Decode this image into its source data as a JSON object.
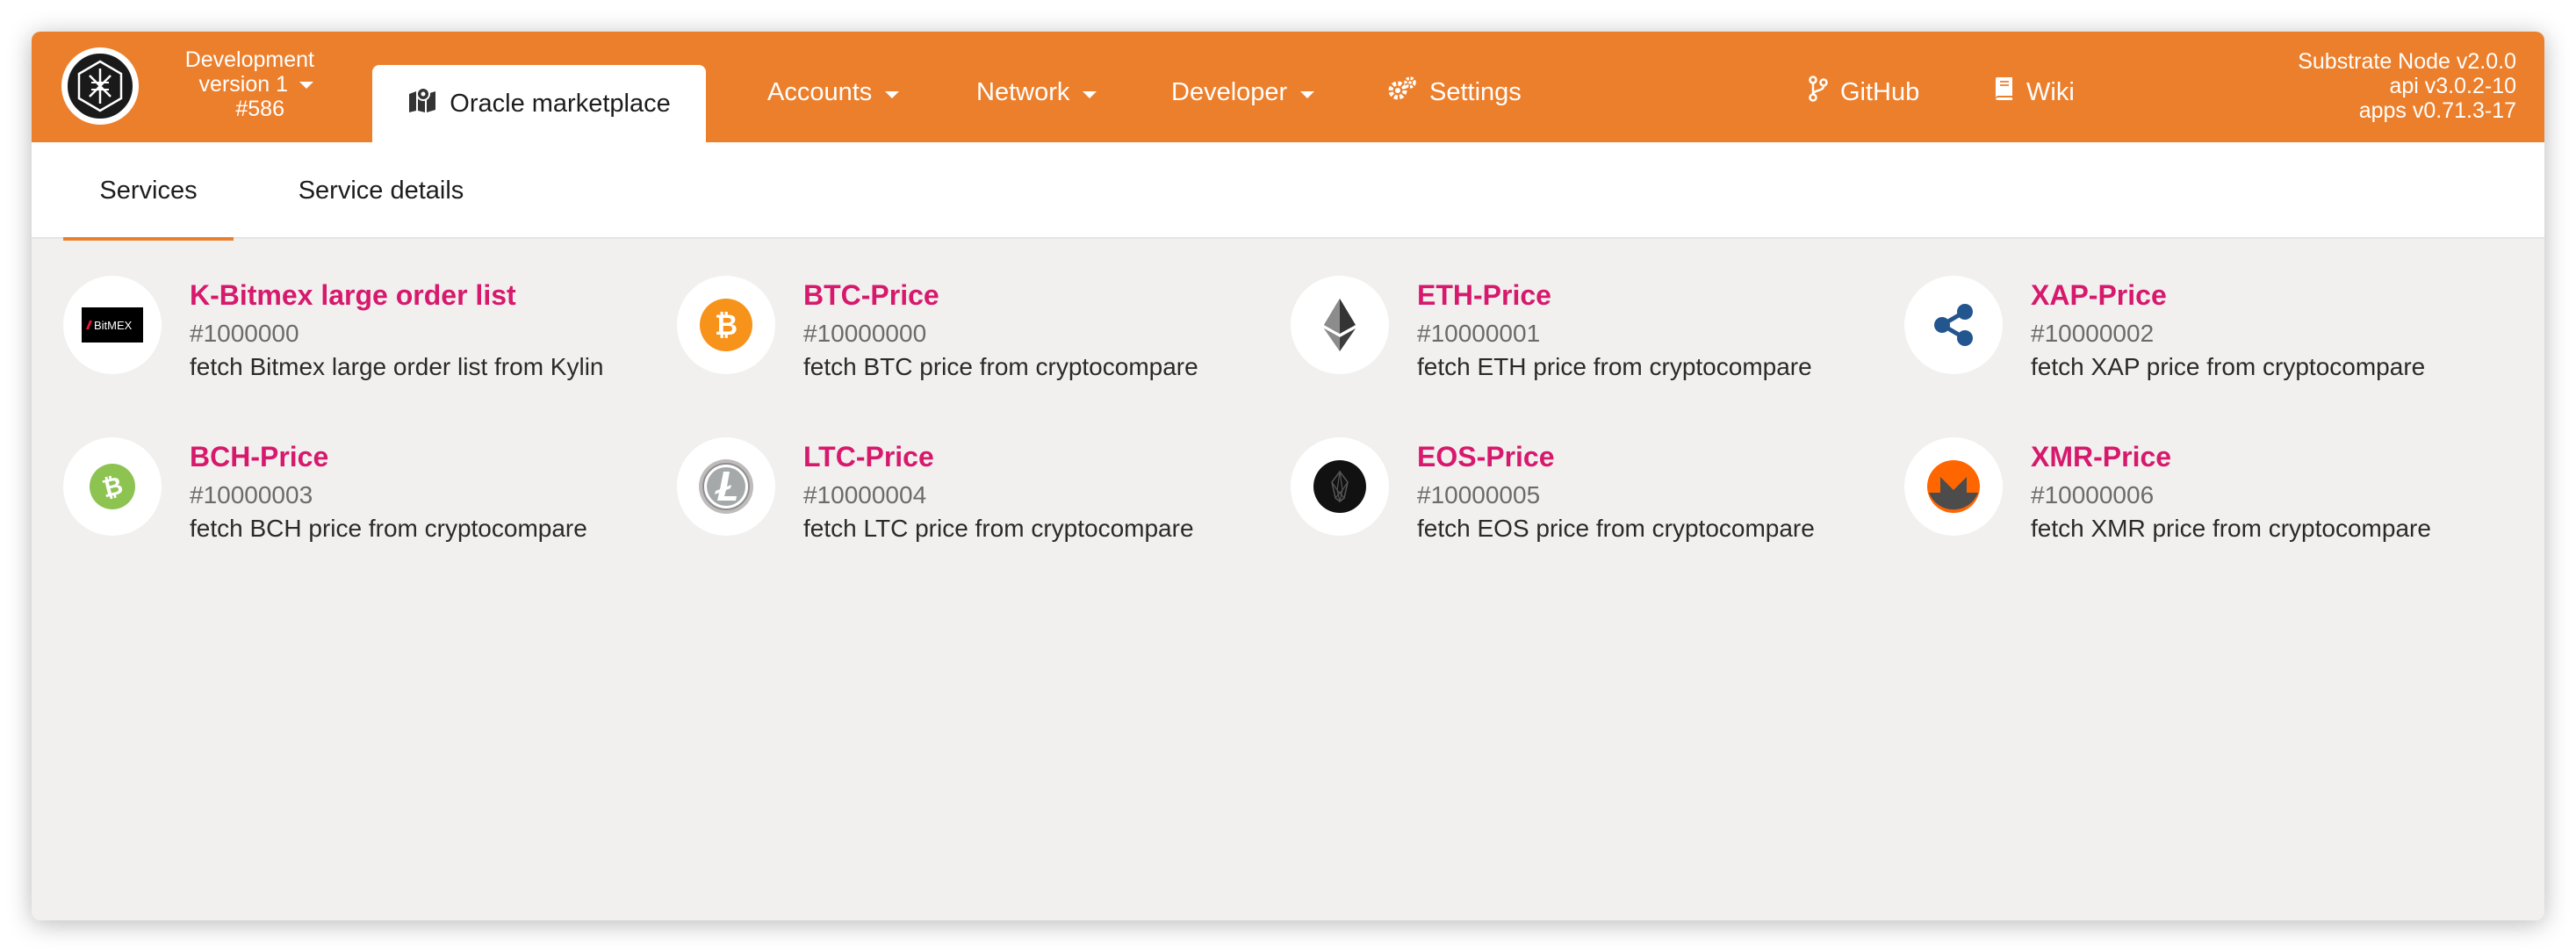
{
  "header": {
    "chain": {
      "name": "Development",
      "version": "version 1",
      "block": "#586"
    },
    "active_tab": {
      "label": "Oracle marketplace",
      "icon": "map-marker-icon"
    },
    "nav": [
      {
        "label": "Accounts",
        "icon": "chevron-down-icon"
      },
      {
        "label": "Network",
        "icon": "chevron-down-icon"
      },
      {
        "label": "Developer",
        "icon": "chevron-down-icon"
      },
      {
        "label": "Settings",
        "icon": "gears-icon"
      },
      {
        "label": "GitHub",
        "icon": "code-branch-icon"
      },
      {
        "label": "Wiki",
        "icon": "book-icon"
      }
    ],
    "node_info": {
      "node": "Substrate Node v2.0.0",
      "api": "api v3.0.2-10",
      "apps": "apps v0.71.3-17"
    },
    "accent_color": "#ec7f2c"
  },
  "subtabs": [
    {
      "label": "Services",
      "active": true
    },
    {
      "label": "Service details",
      "active": false
    }
  ],
  "services": [
    {
      "title": "K-Bitmex large order list",
      "id": "#1000000",
      "description": "fetch Bitmex large order list from Kylin",
      "icon": "bitmex-logo",
      "logo_text": "BitMEX"
    },
    {
      "title": "BTC-Price",
      "id": "#10000000",
      "description": "fetch BTC price from cryptocompare",
      "icon": "bitcoin-icon"
    },
    {
      "title": "ETH-Price",
      "id": "#10000001",
      "description": "fetch ETH price from cryptocompare",
      "icon": "ethereum-icon"
    },
    {
      "title": "XAP-Price",
      "id": "#10000002",
      "description": "fetch XAP price from cryptocompare",
      "icon": "ripple-icon"
    },
    {
      "title": "BCH-Price",
      "id": "#10000003",
      "description": "fetch BCH price from cryptocompare",
      "icon": "bitcoin-cash-icon"
    },
    {
      "title": "LTC-Price",
      "id": "#10000004",
      "description": "fetch LTC price from cryptocompare",
      "icon": "litecoin-icon"
    },
    {
      "title": "EOS-Price",
      "id": "#10000005",
      "description": "fetch EOS price from cryptocompare",
      "icon": "eos-icon"
    },
    {
      "title": "XMR-Price",
      "id": "#10000006",
      "description": "fetch XMR price from cryptocompare",
      "icon": "monero-icon"
    }
  ],
  "colors": {
    "title": "#d6196d",
    "btc": "#f7931a",
    "bch": "#8dc351",
    "xrp": "#23568f",
    "xmr": "#ff6600"
  }
}
